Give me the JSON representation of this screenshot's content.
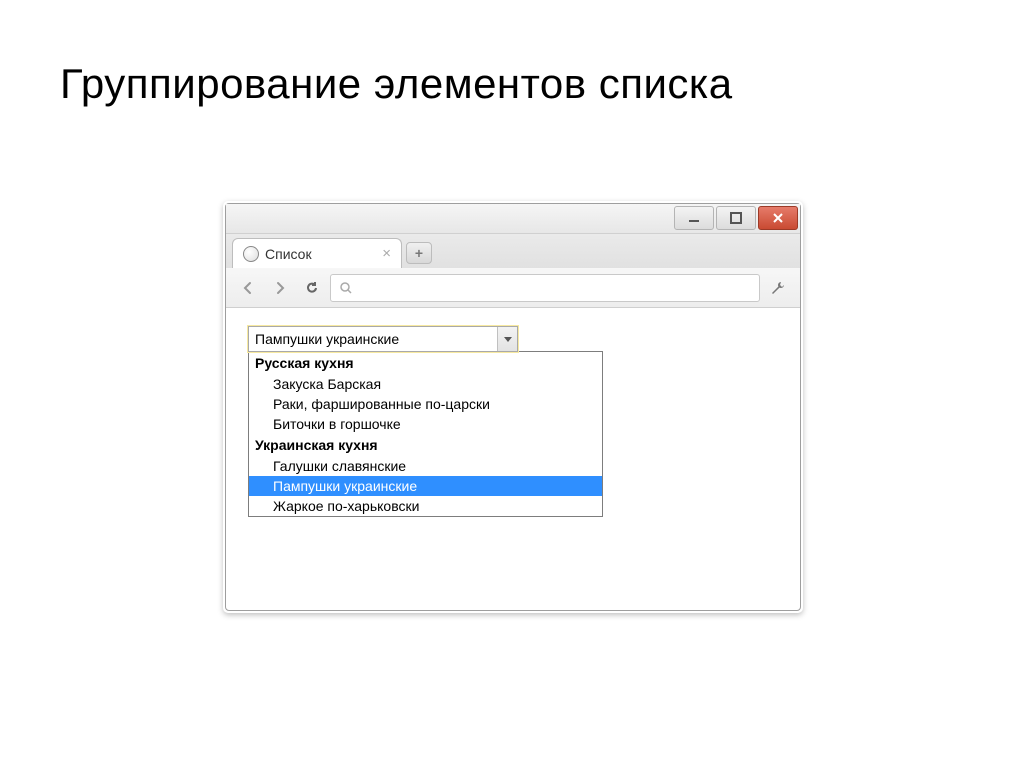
{
  "slide_title": "Группирование элементов списка",
  "browser": {
    "tab_title": "Список",
    "select_value": "Пампушки украинские",
    "groups": [
      {
        "label": "Русская кухня",
        "options": [
          {
            "label": "Закуска Барская",
            "selected": false
          },
          {
            "label": "Раки, фаршированные по-царски",
            "selected": false
          },
          {
            "label": "Биточки в горшочке",
            "selected": false
          }
        ]
      },
      {
        "label": "Украинская кухня",
        "options": [
          {
            "label": "Галушки славянские",
            "selected": false
          },
          {
            "label": "Пампушки украинские",
            "selected": true
          },
          {
            "label": "Жаркое по-харьковски",
            "selected": false
          }
        ]
      }
    ]
  }
}
